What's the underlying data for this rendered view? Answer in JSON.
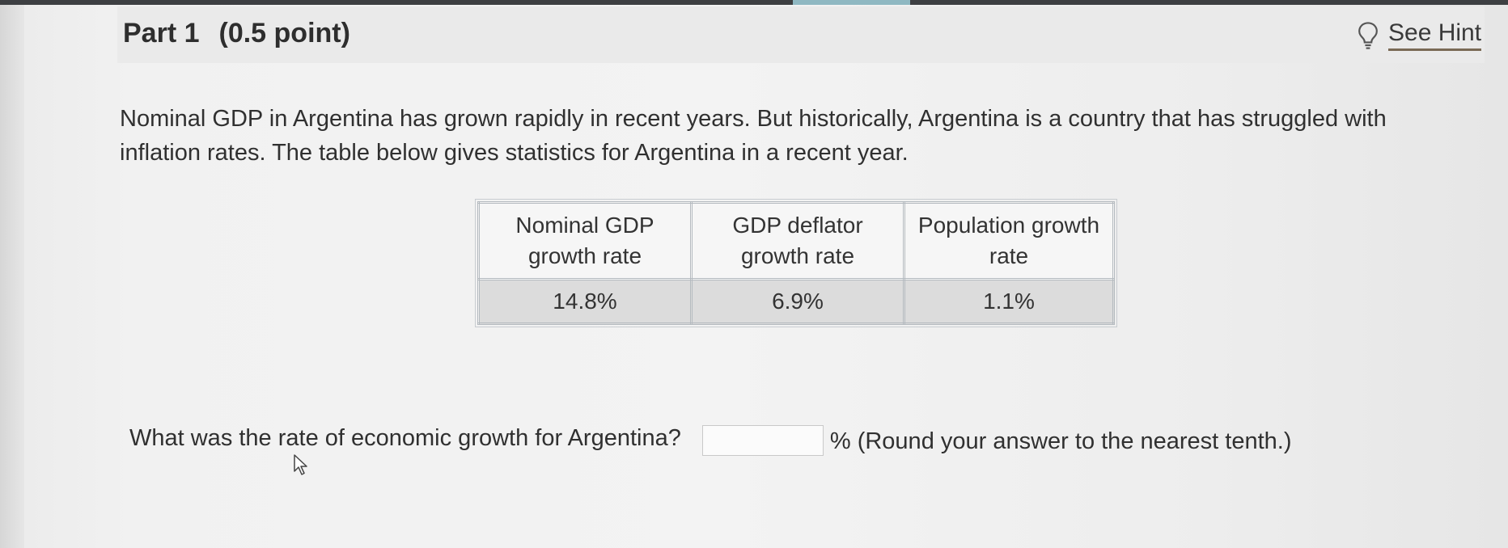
{
  "part": {
    "title": "Part 1",
    "points": "(0.5 point)"
  },
  "hint": {
    "label": "See Hint",
    "icon": "lightbulb-icon"
  },
  "question": {
    "intro": "Nominal GDP in Argentina has grown rapidly in recent years. But historically, Argentina is a country that has struggled with inflation rates. The table below gives statistics for Argentina in a recent year."
  },
  "table": {
    "headers": [
      "Nominal GDP growth rate",
      "GDP deflator growth rate",
      "Population growth rate"
    ],
    "rows": [
      [
        "14.8%",
        "6.9%",
        "1.1%"
      ]
    ]
  },
  "answer": {
    "prompt": "What was the rate of economic growth for Argentina?",
    "value": "",
    "placeholder": "",
    "suffix": "% (Round your answer to the nearest tenth.)"
  },
  "colors": {
    "header_band": "#eaeaea",
    "table_value_cell": "#dcdcdc",
    "hint_underline": "#7a6a55"
  }
}
